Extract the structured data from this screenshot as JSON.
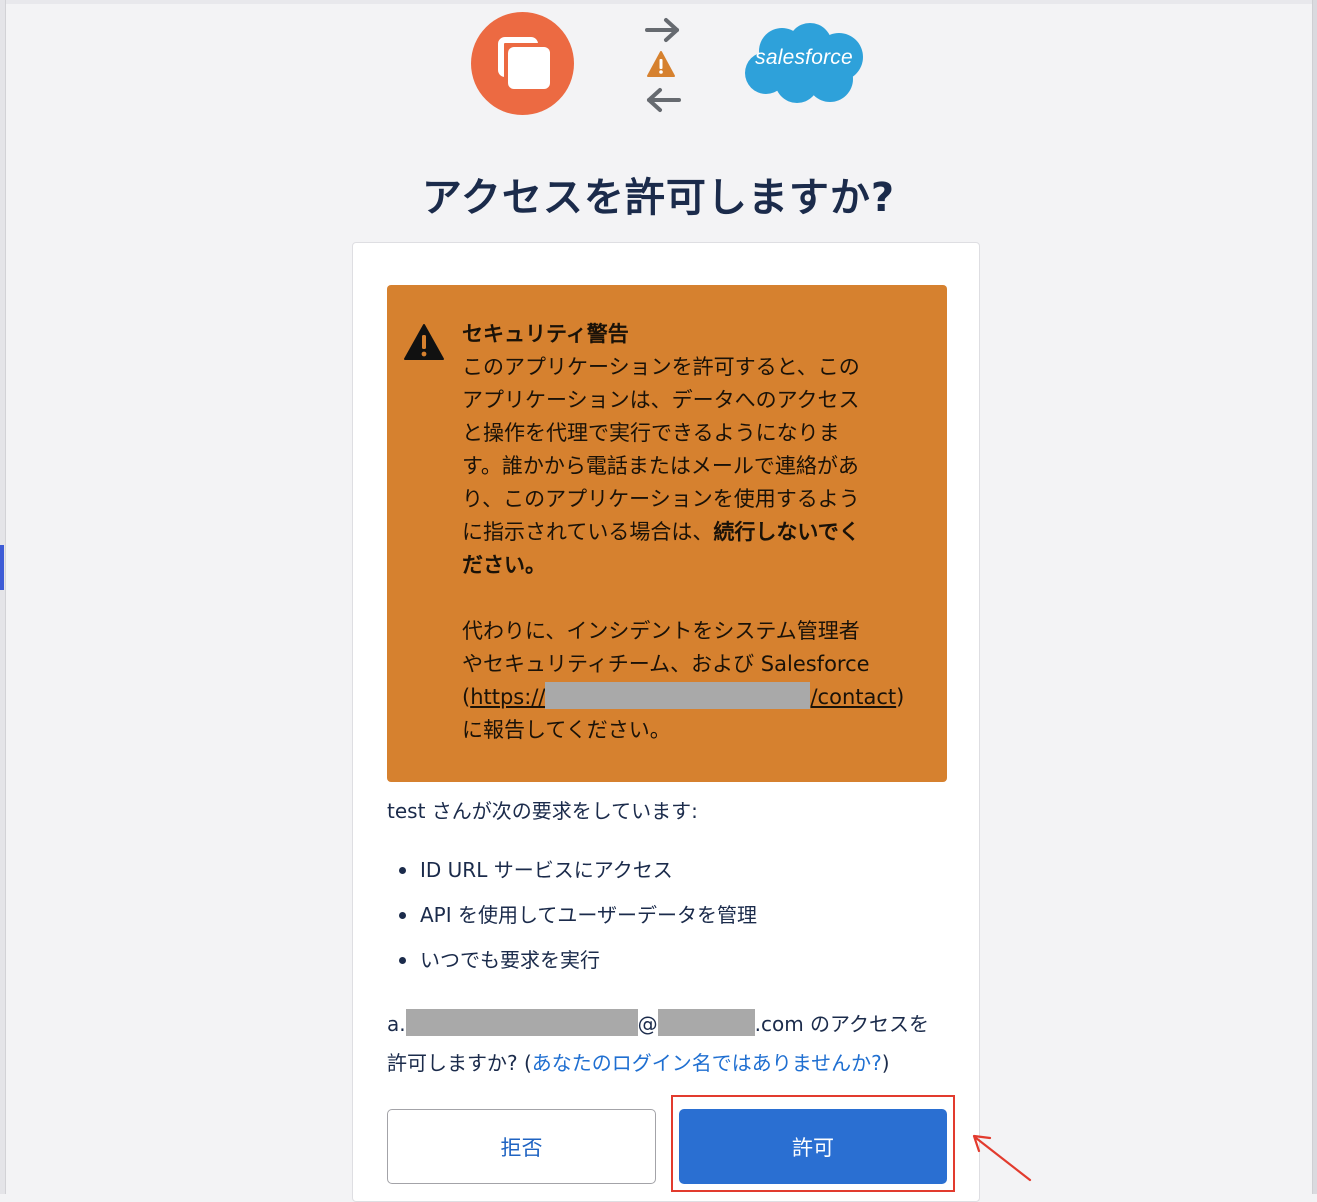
{
  "header": {
    "app_logo": "overlapping-squares-logo",
    "exchange_icons": [
      "arrow-right-icon",
      "warning-icon",
      "arrow-left-icon"
    ],
    "partner_logo_text": "salesforce"
  },
  "title": "アクセスを許可しますか?",
  "warning": {
    "heading": "セキュリティ警告",
    "body_lines": [
      "このアプリケーションを許可すると、この",
      "アプリケーションは、データへのアクセス",
      "と操作を代理で実行できるようになりま",
      "す。誰かから電話またはメールで連絡があ",
      "り、このアプリケーションを使用するよう"
    ],
    "body_last_prefix": "に指示されている場合は、",
    "body_bold_1": "続行しないでく",
    "body_bold_2": "ださい。",
    "para2_lines": [
      "代わりに、インシデントをシステム管理者",
      "やセキュリティチーム、および Salesforce"
    ],
    "url_open": "(",
    "url_prefix": "https://",
    "url_suffix": "/contact",
    "url_close": ")",
    "para2_end": "に報告してください。",
    "background_color": "#d6812f"
  },
  "request": {
    "intro": "test さんが次の要求をしています:",
    "scopes": [
      "ID URL サービスにアクセス",
      "API を使用してユーザーデータを管理",
      "いつでも要求を実行"
    ]
  },
  "account": {
    "email_prefix": "a.",
    "email_at": "@",
    "email_suffix": ".com のアクセスを",
    "question": "許可しますか? (",
    "not_you_link": "あなたのログイン名ではありませんか?",
    "close_paren": ")"
  },
  "buttons": {
    "deny": "拒否",
    "allow": "許可"
  },
  "colors": {
    "accent": "#2a6fd2",
    "title": "#1b2b4b",
    "highlight": "#e23b2e",
    "app_logo": "#ec6a42",
    "salesforce": "#2ea1da"
  }
}
